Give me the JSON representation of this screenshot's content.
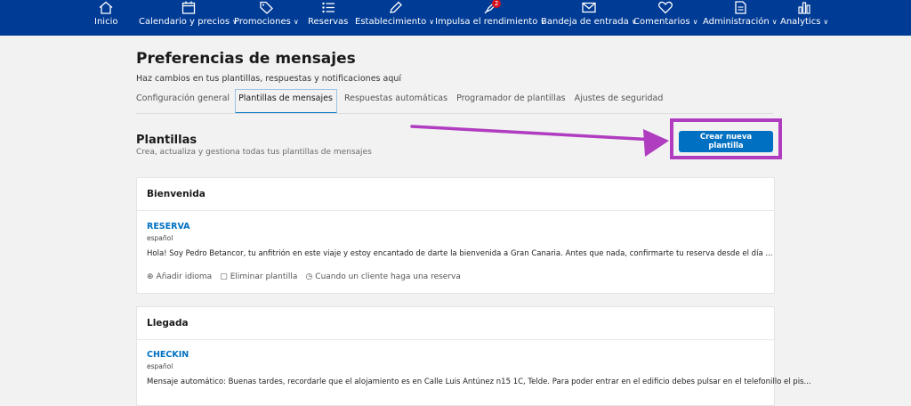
{
  "nav": [
    {
      "label": "Inicio",
      "icon": "home-icon",
      "dropdown": false
    },
    {
      "label": "Calendario y precios",
      "icon": "calendar-icon",
      "dropdown": true
    },
    {
      "label": "Promociones",
      "icon": "tag-icon",
      "dropdown": true
    },
    {
      "label": "Reservas",
      "icon": "list-icon",
      "dropdown": false
    },
    {
      "label": "Establecimiento",
      "icon": "pencil-icon",
      "dropdown": true
    },
    {
      "label": "Impulsa el rendimiento",
      "icon": "rocket-icon",
      "dropdown": true,
      "badge": "2"
    },
    {
      "label": "Bandeja de entrada",
      "icon": "envelope-icon",
      "dropdown": true
    },
    {
      "label": "Comentarios",
      "icon": "heart-icon",
      "dropdown": true
    },
    {
      "label": "Administración",
      "icon": "document-icon",
      "dropdown": true
    },
    {
      "label": "Analytics",
      "icon": "bar-chart-icon",
      "dropdown": true
    }
  ],
  "page": {
    "title": "Preferencias de mensajes",
    "subtitle": "Haz cambios en tus plantillas, respuestas y notificaciones aquí"
  },
  "tabs": [
    {
      "label": "Configuración general",
      "active": false
    },
    {
      "label": "Plantillas de mensajes",
      "active": true
    },
    {
      "label": "Respuestas automáticas",
      "active": false
    },
    {
      "label": "Programador de plantillas",
      "active": false
    },
    {
      "label": "Ajustes de seguridad",
      "active": false
    }
  ],
  "templates_section": {
    "title": "Plantillas",
    "description": "Crea, actualiza y gestiona todas tus plantillas de mensajes",
    "create_button": "Crear nueva plantilla"
  },
  "cards": [
    {
      "header": "Bienvenida",
      "name": "RESERVA",
      "language": "español",
      "body": "Hola! Soy Pedro Betancor, tu anfitrión en este viaje y estoy encantado de darte la bienvenida a Gran Canaria. Antes que nada, confirmarte tu reserva desde el día ...",
      "actions": {
        "add_language": "Añadir idioma",
        "delete_template": "Eliminar plantilla",
        "trigger": "Cuando un cliente haga una reserva"
      }
    },
    {
      "header": "Llegada",
      "name": "CHECKIN",
      "language": "español",
      "body": "Mensaje automático: Buenas tardes, recordarle que el alojamiento es en Calle Luis Antúnez n15 1C, Telde. Para poder entrar en el edificio debes pulsar en el telefonillo el pis..."
    }
  ],
  "colors": {
    "nav_bg": "#003b95",
    "accent": "#0071c2",
    "highlight": "#b03cc0",
    "badge": "#d4111e"
  }
}
